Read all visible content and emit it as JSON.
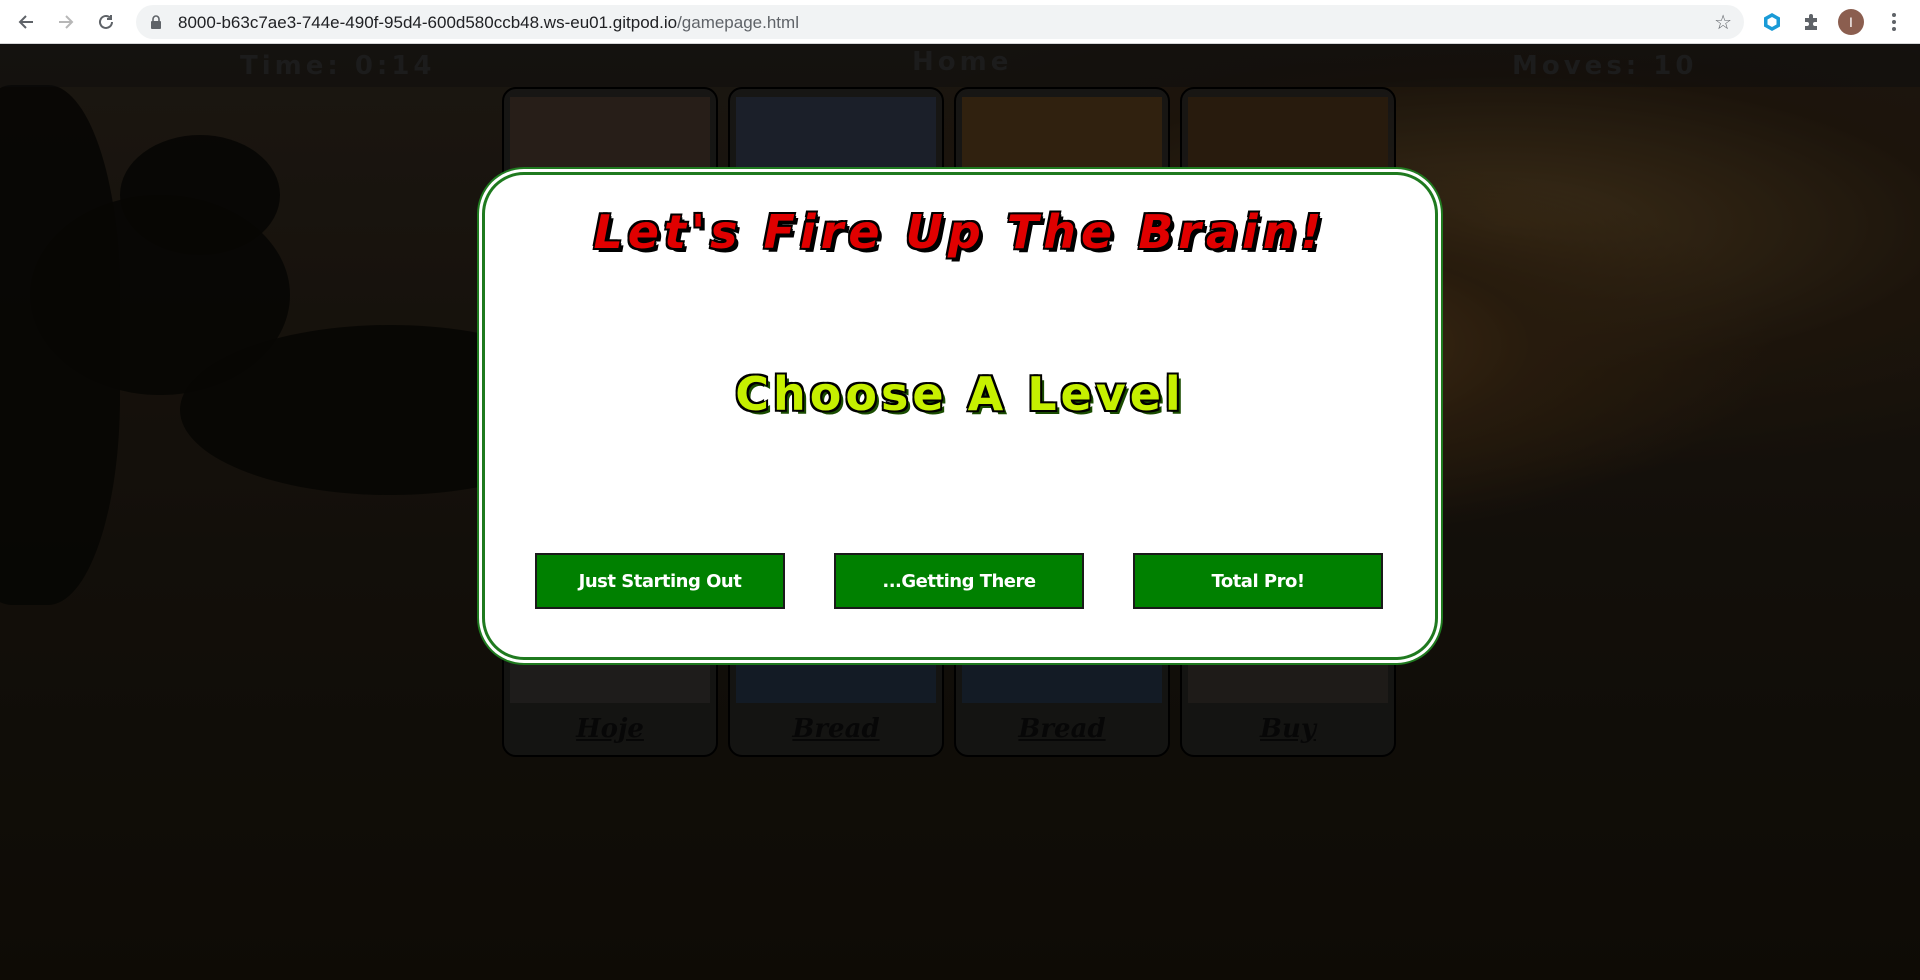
{
  "browser": {
    "url_host": "8000-b63c7ae3-744e-490f-95d4-600d580ccb48.ws-eu01.gitpod.io",
    "url_path": "/gamepage.html",
    "avatar_letter": "I",
    "icons": {
      "back": "back-arrow-icon",
      "forward": "forward-arrow-icon",
      "reload": "reload-icon",
      "lock": "lock-icon",
      "bookmark": "star-icon",
      "extension": "extension-puzzle-icon"
    }
  },
  "game": {
    "time_label": "Time:",
    "time_value": "0:14",
    "home_label": "Home",
    "moves_label": "Moves:",
    "moves_value": "10",
    "cards": [
      {
        "word": "Hoje"
      },
      {
        "word": "Bread"
      },
      {
        "word": "Bread"
      },
      {
        "word": "Buy"
      }
    ]
  },
  "modal": {
    "title": "Let's Fire Up The Brain!",
    "subtitle": "Choose A Level",
    "levels": [
      {
        "label": "Just Starting Out"
      },
      {
        "label": "...Getting There"
      },
      {
        "label": "Total Pro!"
      }
    ]
  },
  "colors": {
    "title_red": "#e00000",
    "subtitle_lime": "#c6f000",
    "button_green": "#008000",
    "modal_border": "#1f7a1f"
  }
}
